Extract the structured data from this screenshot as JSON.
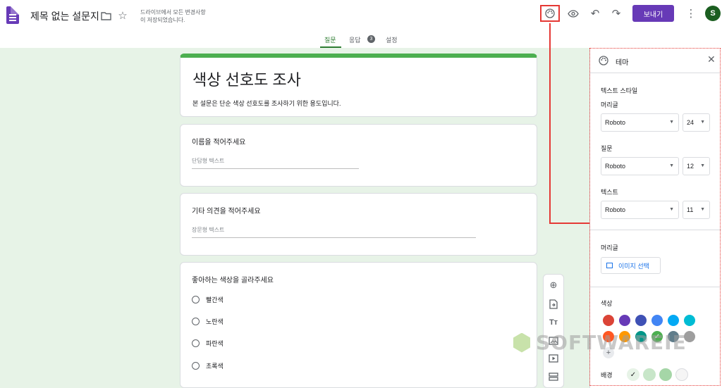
{
  "topbar": {
    "doc_title": "제목 없는 설문지",
    "save_status_line1": "드라이브에서 모든 변경사항",
    "save_status_line2": "이 저장되었습니다.",
    "send_label": "보내기",
    "avatar_letter": "S"
  },
  "tabs": {
    "questions": "질문",
    "responses": "응답",
    "responses_count": "3",
    "settings": "설정",
    "active": "질문"
  },
  "form": {
    "title": "색상 선호도 조사",
    "description": "본 설문은 단순 색상 선호도를 조사하기 위한 용도입니다.",
    "q1": {
      "title": "이름을 적어주세요",
      "placeholder": "단답형 텍스트"
    },
    "q2": {
      "title": "기타 의견을 적어주세요",
      "placeholder": "장문형 텍스트"
    },
    "q3": {
      "title": "좋아하는 색상을 골라주세요",
      "options": [
        "빨간색",
        "노란색",
        "파란색",
        "초록색"
      ]
    }
  },
  "theme_panel": {
    "title": "테마",
    "text_style_label": "텍스트 스타일",
    "header_label": "머리글",
    "header_font": "Roboto",
    "header_size": "24",
    "question_label": "질문",
    "question_font": "Roboto",
    "question_size": "12",
    "text_label": "텍스트",
    "text_font": "Roboto",
    "text_size": "11",
    "header_image_label": "머리글",
    "image_button": "이미지 선택",
    "color_label": "색상",
    "background_label": "배경",
    "colors": [
      "#db4437",
      "#673ab7",
      "#3f51b5",
      "#4285f4",
      "#03a9f4",
      "#00bcd4",
      "#ff5722",
      "#ff9800",
      "#009688",
      "#4caf50",
      "#607d8b",
      "#9e9e9e"
    ],
    "selected_color": "#4caf50",
    "backgrounds": [
      "#e7f3e7",
      "#c8e6c9",
      "#a5d6a7",
      "#f5f5f5"
    ],
    "selected_background": "#e7f3e7"
  },
  "watermark": {
    "text": "SOFTWAREIE"
  }
}
